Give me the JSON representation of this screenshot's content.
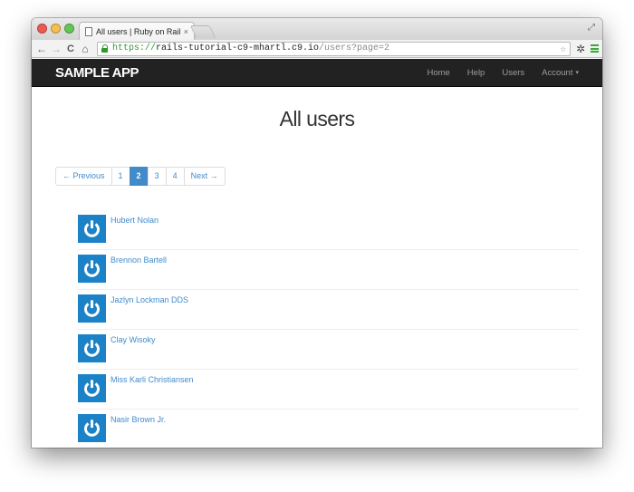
{
  "browser": {
    "tab_title": "All users | Ruby on Rails T",
    "tab_close": "×",
    "url_scheme": "https://",
    "url_host": "rails-tutorial-c9-mhartl.c9.io",
    "url_path": "/users?page=2",
    "back_glyph": "←",
    "forward_glyph": "→",
    "reload_glyph": "C",
    "home_glyph": "⌂",
    "star_glyph": "☆",
    "settings_glyph": "✲",
    "fullscreen_glyph": "⤢"
  },
  "navbar": {
    "brand": "SAMPLE APP",
    "links": [
      "Home",
      "Help",
      "Users",
      "Account"
    ],
    "account_caret": "▾"
  },
  "page": {
    "heading": "All users"
  },
  "pagination": {
    "previous": "← Previous",
    "pages": [
      "1",
      "2",
      "3",
      "4"
    ],
    "current": "2",
    "next": "Next →"
  },
  "users": [
    "Hubert Nolan",
    "Brennon Bartell",
    "Jazlyn Lockman DDS",
    "Clay Wisoky",
    "Miss Karli Christiansen",
    "Nasir Brown Jr."
  ],
  "colors": {
    "navbar_bg": "#222222",
    "link": "#428bca",
    "gravatar_bg": "#1b82c8"
  }
}
